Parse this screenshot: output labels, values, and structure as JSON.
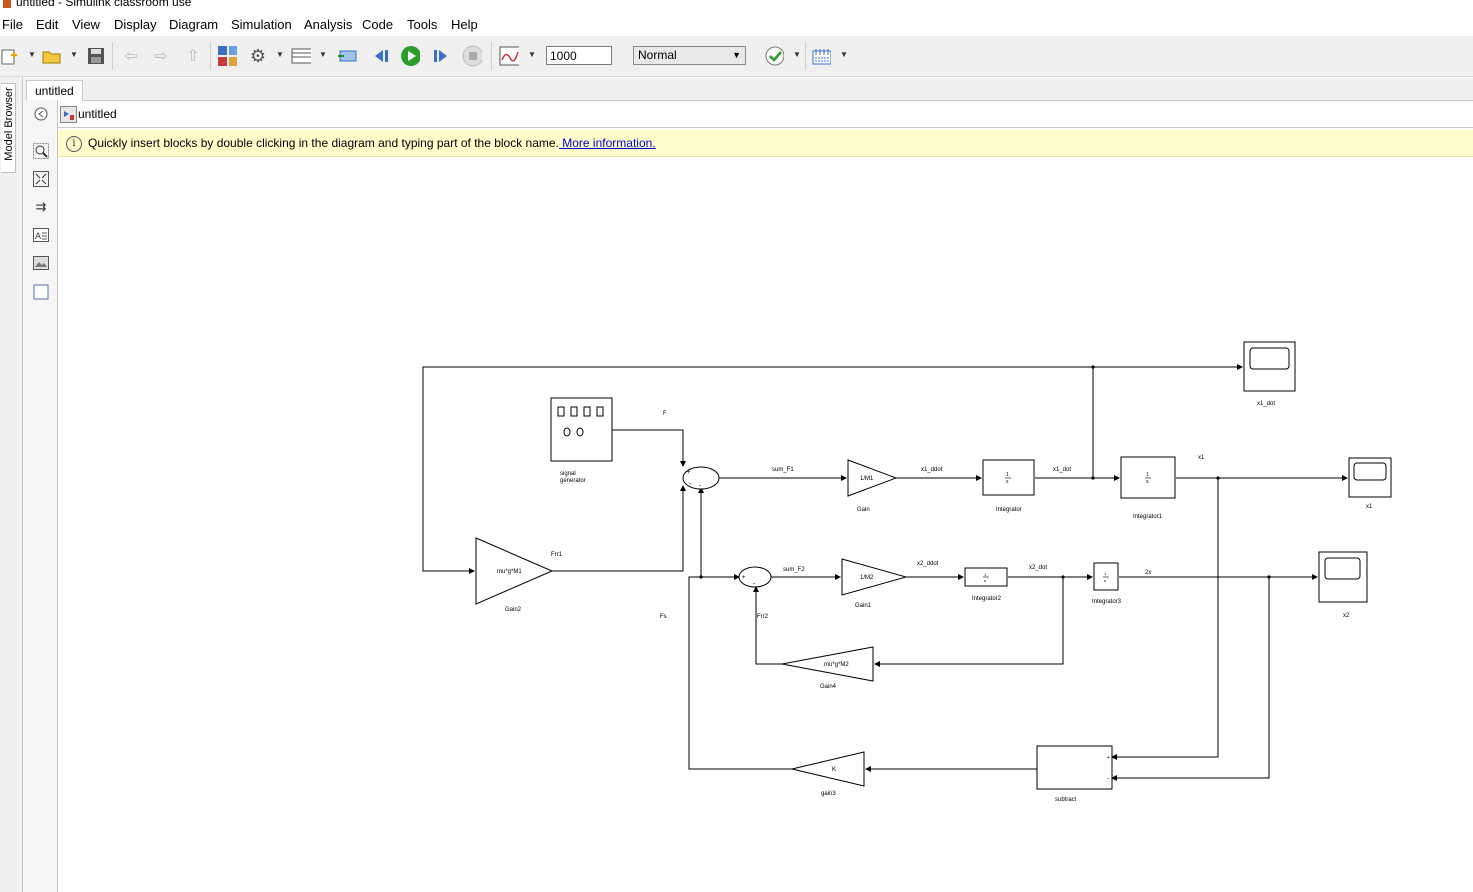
{
  "window": {
    "title": "untitled - Simulink classroom use"
  },
  "menu": [
    "File",
    "Edit",
    "View",
    "Display",
    "Diagram",
    "Simulation",
    "Analysis",
    "Code",
    "Tools",
    "Help"
  ],
  "toolbar": {
    "stop_time": "1000",
    "sim_mode": "Normal"
  },
  "sidebar": {
    "model_browser_label": "Model Browser"
  },
  "tabs": [
    {
      "label": "untitled"
    }
  ],
  "address": {
    "path": "untitled"
  },
  "infobar": {
    "text": "Quickly insert blocks by double clicking in the diagram and typing part of the block name.",
    "link": " More information."
  },
  "diagram": {
    "blocks": {
      "signal_generator": {
        "name_line1": "signal",
        "name_line2": "generator"
      },
      "gain": {
        "content": "1/M1",
        "name": "Gain"
      },
      "integrator": {
        "name": "Integrator"
      },
      "integrator1": {
        "name": "Integrator1"
      },
      "x1_dot_scope": {
        "name": "x1_dot"
      },
      "x1_scope": {
        "name": "x1"
      },
      "gain2": {
        "content": "mu*g*M1",
        "name": "Gain2"
      },
      "gain1": {
        "content": "1/M2",
        "name": "Gain1"
      },
      "integrator2": {
        "name": "Integrator2"
      },
      "integrator3": {
        "name": "Integrator3"
      },
      "x2_scope": {
        "name": "x2"
      },
      "gain4": {
        "content": "mu*g*M2",
        "name": "Gain4"
      },
      "gain3": {
        "content": "K",
        "name": "gain3"
      },
      "subtract": {
        "name": "subtract"
      },
      "integrator_content": {
        "num": "1",
        "den": "s"
      }
    },
    "signals": {
      "F": "F",
      "sum_F1": "sum_F1",
      "x1_ddot": "x1_ddot",
      "x1_dot": "x1_dot",
      "x1": "x1",
      "Frr1": "Frr1",
      "Fs": "Fs",
      "sum_F2": "sum_F2",
      "x2_ddot": "x2_ddot",
      "x2_dot": "x2_dot",
      "x2": "2x",
      "Frr2": "Frr2"
    }
  }
}
